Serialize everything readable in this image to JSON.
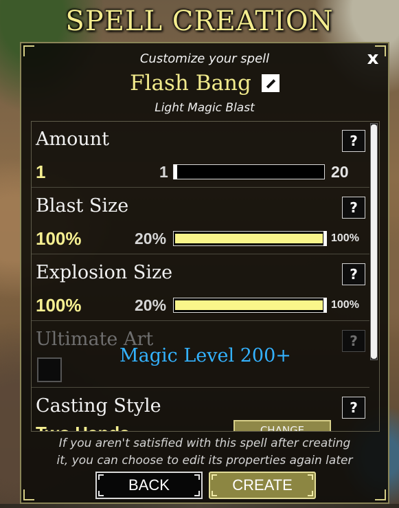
{
  "window": {
    "title": "SPELL CREATION",
    "subtitle": "Customize your spell",
    "close_label": "x"
  },
  "spell": {
    "name": "Flash Bang",
    "type": "Light Magic Blast"
  },
  "properties": [
    {
      "label": "Amount",
      "help": "?",
      "value": "1",
      "min_label": "1",
      "max_label": "20",
      "fill": 0.0
    },
    {
      "label": "Blast Size",
      "help": "?",
      "value": "100%",
      "min_label": "20%",
      "max_label": "100%",
      "fill": 1.0
    },
    {
      "label": "Explosion Size",
      "help": "?",
      "value": "100%",
      "min_label": "20%",
      "max_label": "100%",
      "fill": 1.0
    }
  ],
  "ultimate_art": {
    "label": "Ultimate Art",
    "help": "?",
    "requirement": "Magic Level 200+",
    "checked": false
  },
  "casting_style": {
    "label": "Casting Style",
    "help": "?",
    "value": "Two Hands",
    "change_label": "CHANGE"
  },
  "footer": {
    "note_line1": "If you aren't satisfied with this spell after creating",
    "note_line2": "it, you can choose to edit its properties again later",
    "back_label": "BACK",
    "create_label": "CREATE"
  },
  "colors": {
    "accent_gold": "#f5ef91",
    "title_gold": "#f3ec8e",
    "requirement_blue": "#34b2ff",
    "panel_bg": "#0c0b08"
  }
}
